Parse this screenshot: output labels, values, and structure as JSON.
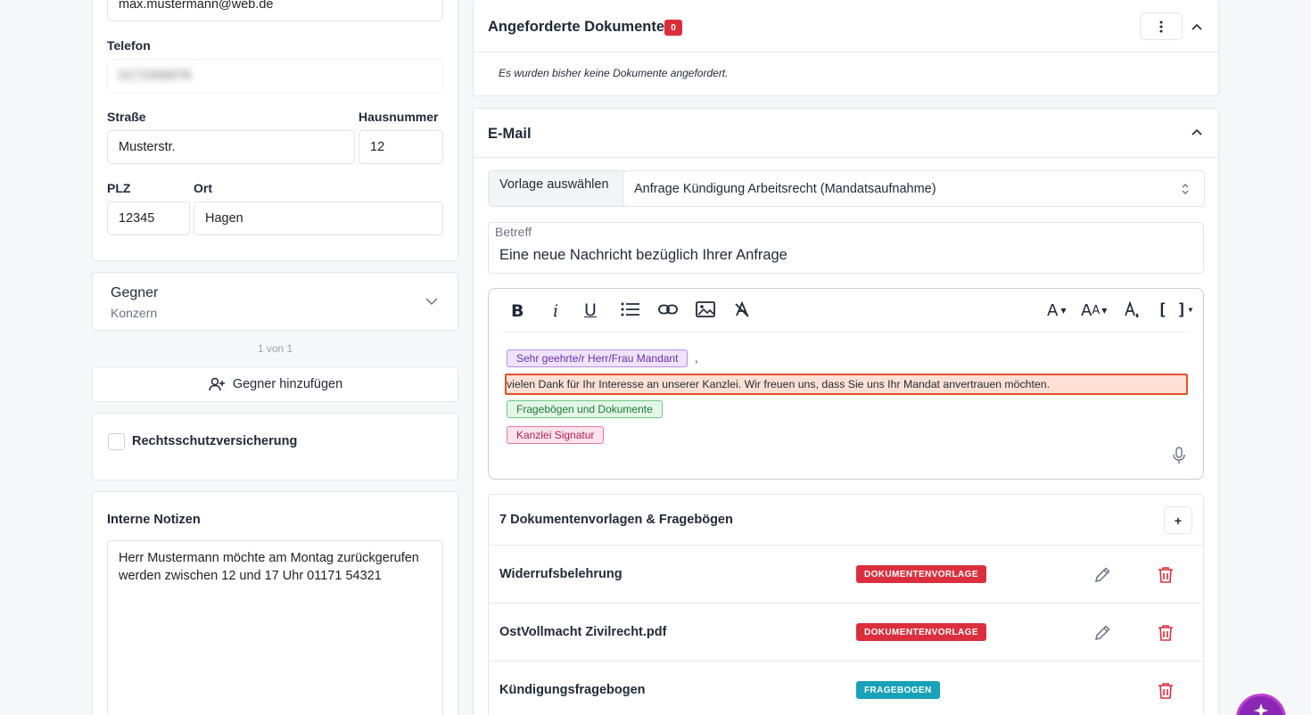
{
  "left": {
    "email_value": "max.mustermann@web.de",
    "telefon_label": "Telefon",
    "telefon_value": "0171556678",
    "strasse_label": "Straße",
    "strasse_value": "Musterstr.",
    "hausnummer_label": "Hausnummer",
    "hausnummer_value": "12",
    "plz_label": "PLZ",
    "plz_value": "12345",
    "ort_label": "Ort",
    "ort_value": "Hagen",
    "gegner_title": "Gegner",
    "gegner_subtitle": "Konzern",
    "pagination": "1 von 1",
    "add_gegner_label": "Gegner hinzufügen",
    "rechtsschutz_label": "Rechtsschutzversicherung",
    "notizen_label": "Interne Notizen",
    "notizen_value": "Herr Mustermann möchte am Montag zurückgerufen werden zwischen 12 und 17 Uhr 01171 54321"
  },
  "documents_panel": {
    "title": "Angeforderte Dokumente",
    "count": "0",
    "empty_text": "Es wurden bisher keine Dokumente angefordert."
  },
  "email_panel": {
    "title": "E-Mail",
    "vorlage_label": "Vorlage auswählen",
    "vorlage_value": "Anfrage Kündigung Arbeitsrecht (Mandatsaufnahme)",
    "betreff_label": "Betreff",
    "betreff_value": "Eine neue Nachricht bezüglich Ihrer Anfrage",
    "editor": {
      "greeting_chip": "Sehr geehrte/r Herr/Frau Mandant",
      "comma": ",",
      "body_line": "vielen Dank für Ihr Interesse an unserer Kanzlei. Wir freuen uns, dass Sie uns Ihr Mandat anvertrauen möchten.",
      "docs_chip": "Fragebögen und Dokumente",
      "signature_chip": "Kanzlei Signatur"
    },
    "templates": {
      "title": "7 Dokumentenvorlagen & Fragebögen",
      "add_label": "+",
      "rows": [
        {
          "name": "Widerrufsbelehrung",
          "type": "DOKUMENTENVORLAGE"
        },
        {
          "name": "OstVollmacht Zivilrecht.pdf",
          "type": "DOKUMENTENVORLAGE"
        },
        {
          "name": "Kündigungsfragebogen",
          "type": "FRAGEBOGEN"
        }
      ]
    }
  },
  "colors": {
    "red": "#dc2f3d",
    "teal": "#17a2b8",
    "purple_chip": "#efe3fb",
    "green_chip": "#e3f6e7",
    "pink_chip": "#fde4ec",
    "highlight": "#fde0d3"
  }
}
